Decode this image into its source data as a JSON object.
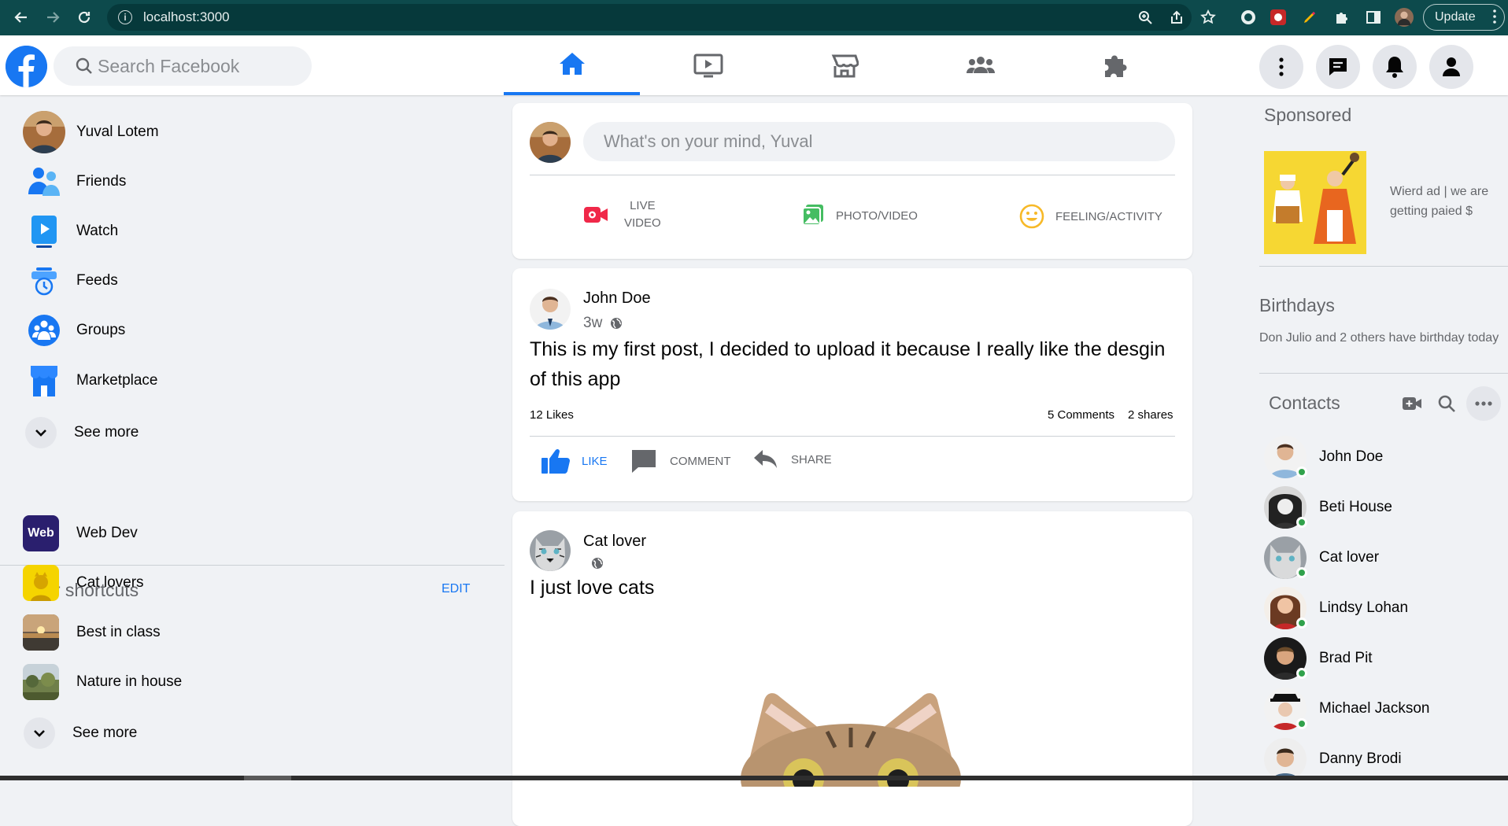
{
  "browser": {
    "url": "localhost:3000",
    "update_label": "Update"
  },
  "search": {
    "placeholder": "Search Facebook"
  },
  "sidebar": {
    "items": [
      {
        "label": "Yuval Lotem"
      },
      {
        "label": "Friends"
      },
      {
        "label": "Watch"
      },
      {
        "label": "Feeds"
      },
      {
        "label": "Groups"
      },
      {
        "label": "Marketplace"
      },
      {
        "label": "See more"
      }
    ],
    "shortcuts_title": "Your shortcuts",
    "edit_label": "EDIT",
    "shortcuts": [
      {
        "label": "Web Dev",
        "thumb_text": "Web"
      },
      {
        "label": "Cat lovers"
      },
      {
        "label": "Best in class"
      },
      {
        "label": "Nature in house"
      }
    ],
    "see_more_2": "See more"
  },
  "composer": {
    "placeholder": "What's on your mind, Yuval",
    "live_label_1": "LIVE",
    "live_label_2": "VIDEO",
    "photo_label": "PHOTO/VIDEO",
    "feeling_label": "FEELING/ACTIVITY"
  },
  "posts": [
    {
      "author": "John Doe",
      "time": "3w",
      "text": "This is my first post, I decided to upload it because I really like the desgin of this app",
      "likes": "12 Likes",
      "comments": "5 Comments",
      "shares": "2 shares",
      "like_label": "LIKE",
      "comment_label": "COMMENT",
      "share_label": "SHARE"
    },
    {
      "author": "Cat lover",
      "time": "",
      "text": "I just love cats"
    }
  ],
  "right": {
    "sponsored_title": "Sponsored",
    "ad_text": "Wierd ad | we are getting paied $",
    "birthdays_title": "Birthdays",
    "birthday_text": "Don Julio and 2 others have birthday today",
    "contacts_title": "Contacts",
    "contacts": [
      {
        "name": "John Doe"
      },
      {
        "name": "Beti House"
      },
      {
        "name": "Cat lover"
      },
      {
        "name": "Lindsy Lohan"
      },
      {
        "name": "Brad Pit"
      },
      {
        "name": "Michael Jackson"
      },
      {
        "name": "Danny Brodi"
      }
    ]
  },
  "colors": {
    "accent": "#1877f2",
    "online": "#31a24c",
    "browser_bar": "#0d4a4c"
  }
}
